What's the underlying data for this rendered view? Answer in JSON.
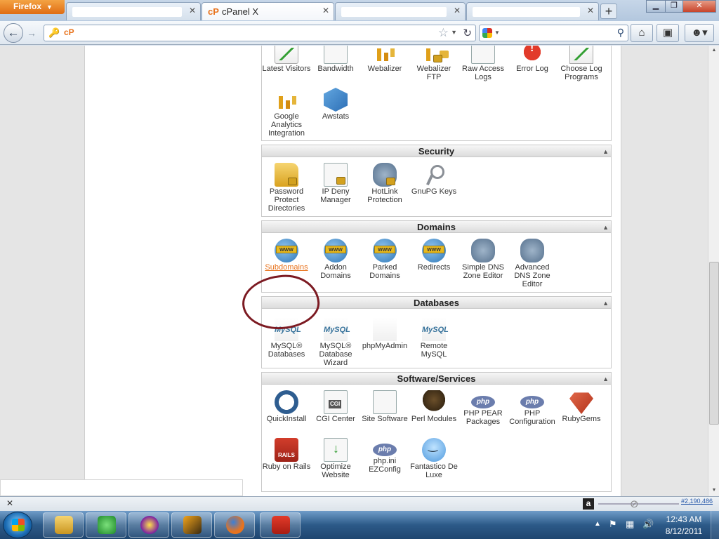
{
  "browser": {
    "menu_button": "Firefox",
    "tabs": [
      {
        "title": "",
        "active": false
      },
      {
        "title": "cPanel X",
        "favicon": "cP",
        "active": true
      },
      {
        "title": "",
        "active": false
      },
      {
        "title": "",
        "active": false
      }
    ],
    "close_glyph": "✕",
    "new_tab": "+",
    "url_favicon": "cP",
    "icons": {
      "back": "back-arrow-icon",
      "forward": "forward-arrow-icon",
      "reload": "reload-icon",
      "star": "bookmark-star-icon",
      "search_engine": "google-icon",
      "search": "magnifier-icon",
      "home": "home-icon",
      "bookmarks": "bookmarks-menu-icon",
      "addon": "addon-face-icon"
    }
  },
  "sections": {
    "logs": {
      "items": [
        "Latest Visitors",
        "Bandwidth",
        "Webalizer",
        "Webalizer FTP",
        "Raw Access Logs",
        "Error Log",
        "Choose Log Programs",
        "Google Analytics Integration",
        "Awstats"
      ]
    },
    "security": {
      "title": "Security",
      "items": [
        "Password Protect Directories",
        "IP Deny Manager",
        "HotLink Protection",
        "GnuPG Keys"
      ]
    },
    "domains": {
      "title": "Domains",
      "items": [
        "Subdomains",
        "Addon Domains",
        "Parked Domains",
        "Redirects",
        "Simple DNS Zone Editor",
        "Advanced DNS Zone Editor"
      ]
    },
    "databases": {
      "title": "Databases",
      "items": [
        "MySQL® Databases",
        "MySQL® Database Wizard",
        "phpMyAdmin",
        "Remote MySQL"
      ]
    },
    "software": {
      "title": "Software/Services",
      "items": [
        "QuickInstall",
        "CGI Center",
        "Site Software",
        "Perl Modules",
        "PHP PEAR Packages",
        "PHP Configuration",
        "RubyGems",
        "Ruby on Rails",
        "Optimize Website",
        "php.ini EZConfig",
        "Fantastico De Luxe"
      ]
    }
  },
  "icon_text": {
    "www": "WWW",
    "mysql": "MySQL",
    "php": "php",
    "cgi": "CGI",
    "rails": "RAILS"
  },
  "collapse_glyph": "▲",
  "statusbar": {
    "close": "✕",
    "alexa_letter": "a",
    "alexa_rank": "#2,190,486"
  },
  "taskbar": {
    "time": "12:43 AM",
    "date": "8/12/2011",
    "apps": [
      "file-explorer",
      "green-app",
      "yahoo-messenger",
      "winamp",
      "firefox",
      "adobe-reader"
    ]
  },
  "colors": {
    "accent_link": "#e8731d",
    "annotation_circle": "#7c1a22",
    "firefox_orange": "#e8731d"
  }
}
